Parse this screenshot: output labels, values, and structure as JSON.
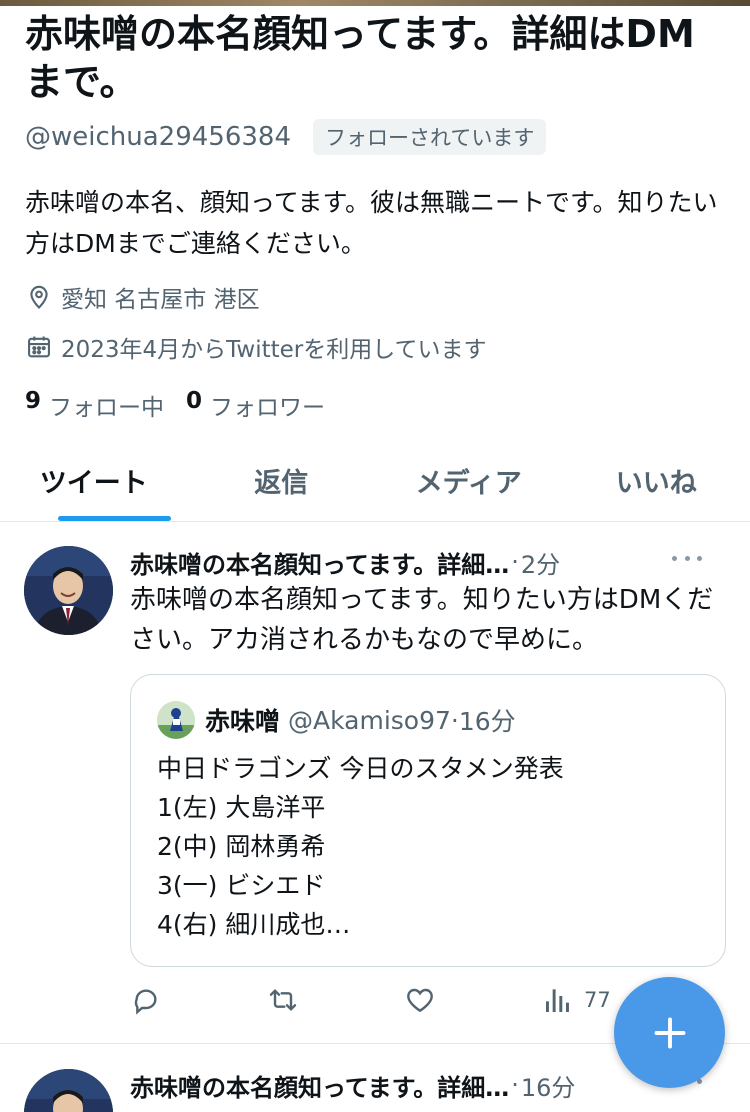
{
  "profile": {
    "name": "赤味噌の本名顔知ってます。詳細はDMまで。",
    "handle": "@weichua29456384",
    "follows_you": "フォローされています",
    "bio": "赤味噌の本名、顔知ってます。彼は無職ニートです。知りたい方はDMまでご連絡ください。",
    "location": "愛知 名古屋市 港区",
    "joined": "2023年4月からTwitterを利用しています",
    "following_count": "9",
    "following_label": "フォロー中",
    "followers_count": "0",
    "followers_label": "フォロワー"
  },
  "tabs": [
    {
      "label": "ツイート",
      "active": true
    },
    {
      "label": "返信",
      "active": false
    },
    {
      "label": "メディア",
      "active": false
    },
    {
      "label": "いいね",
      "active": false
    }
  ],
  "tweets": [
    {
      "author": "赤味噌の本名顔知ってます。詳細…",
      "time": "2分",
      "text": "赤味噌の本名顔知ってます。知りたい方はDMください。アカ消されるかもなので早めに。",
      "quote": {
        "name": "赤味噌",
        "handle": "@Akamiso97",
        "time": "16分",
        "lines": [
          "中日ドラゴンズ 今日のスタメン発表",
          "1(左) 大島洋平",
          "2(中) 岡林勇希",
          "3(一) ビシエド",
          "4(右) 細川成也…"
        ]
      },
      "views": "77"
    },
    {
      "author": "赤味噌の本名顔知ってます。詳細…",
      "time": "16分"
    }
  ],
  "colors": {
    "accent": "#1d9bf0",
    "fab": "#4a99e9",
    "secondary_text": "#536471"
  },
  "icons": {
    "location": "location-pin-icon",
    "calendar": "calendar-icon",
    "reply": "reply-icon",
    "retweet": "retweet-icon",
    "like": "heart-icon",
    "views": "views-icon",
    "compose": "plus-icon",
    "more": "more-icon"
  }
}
